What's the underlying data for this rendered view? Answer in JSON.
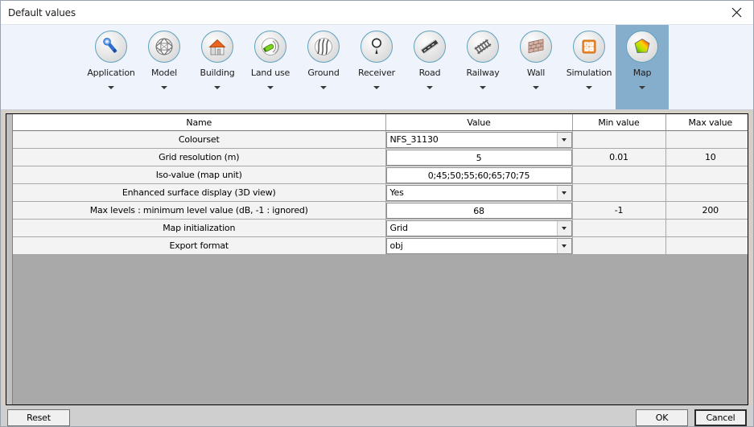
{
  "window": {
    "title": "Default values",
    "close_icon": "close-icon"
  },
  "ribbon": {
    "tabs": [
      {
        "label": "Application",
        "icon": "wrench-icon",
        "selected": false
      },
      {
        "label": "Model",
        "icon": "globe-mesh-icon",
        "selected": false
      },
      {
        "label": "Building",
        "icon": "house-icon",
        "selected": false
      },
      {
        "label": "Land use",
        "icon": "land-use-icon",
        "selected": false
      },
      {
        "label": "Ground",
        "icon": "ground-waves-icon",
        "selected": false
      },
      {
        "label": "Receiver",
        "icon": "receiver-pin-icon",
        "selected": false
      },
      {
        "label": "Road",
        "icon": "road-icon",
        "selected": false
      },
      {
        "label": "Railway",
        "icon": "railway-icon",
        "selected": false
      },
      {
        "label": "Wall",
        "icon": "wall-brick-icon",
        "selected": false
      },
      {
        "label": "Simulation",
        "icon": "calculator-icon",
        "selected": false
      },
      {
        "label": "Map",
        "icon": "colour-map-icon",
        "selected": true
      }
    ],
    "chevron_icon": "chevron-down-icon"
  },
  "table": {
    "columns": [
      "Name",
      "Value",
      "Min value",
      "Max value"
    ],
    "rows": [
      {
        "name": "Colourset",
        "value": "NFS_31130",
        "editor": "combo",
        "min": "",
        "max": ""
      },
      {
        "name": "Grid resolution (m)",
        "value": "5",
        "editor": "text",
        "min": "0.01",
        "max": "10"
      },
      {
        "name": "Iso-value (map unit)",
        "value": "0;45;50;55;60;65;70;75",
        "editor": "text",
        "min": "",
        "max": ""
      },
      {
        "name": "Enhanced surface display (3D view)",
        "value": "Yes",
        "editor": "combo",
        "min": "",
        "max": ""
      },
      {
        "name": "Max levels : minimum level value (dB, -1 : ignored)",
        "value": "68",
        "editor": "text",
        "min": "-1",
        "max": "200"
      },
      {
        "name": "Map initialization",
        "value": "Grid",
        "editor": "combo",
        "min": "",
        "max": ""
      },
      {
        "name": "Export format",
        "value": "obj",
        "editor": "combo",
        "min": "",
        "max": ""
      }
    ]
  },
  "footer": {
    "reset_label": "Reset",
    "ok_label": "OK",
    "cancel_label": "Cancel"
  },
  "colors": {
    "name_text": "#008000",
    "selected_tab": "#85adcc",
    "ribbon_bg": "#eff3fb",
    "grid_empty": "#a9a9a9"
  }
}
